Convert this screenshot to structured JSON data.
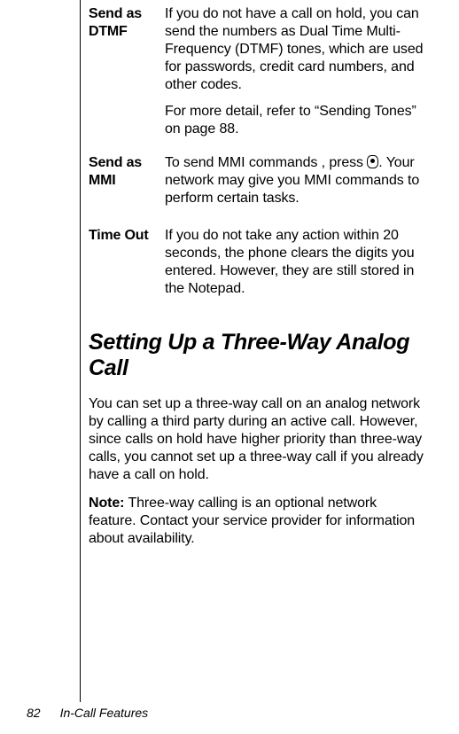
{
  "definitions": [
    {
      "term": "Send as DTMF",
      "desc1": "If you do not have a call on hold, you can send the numbers as Dual Time Multi-Frequency (DTMF) tones, which are used for passwords, credit card numbers, and other codes.",
      "desc2": "For more detail, refer to “Sending Tones” on page 88."
    },
    {
      "term": "Send as MMI",
      "desc_pre": "To send MMI commands , press ",
      "icon": "key-icon",
      "desc_post": ". Your network may give you MMI commands to perform certain tasks."
    },
    {
      "term": "Time Out",
      "desc1": "If you do not take any action within 20 seconds, the phone clears the digits you entered. However, they are still stored in the Notepad."
    }
  ],
  "heading": "Setting Up a Three-Way Analog Call",
  "paragraphs": {
    "p1": "You can set up a three-way call on an analog network by calling a third party during an active call. However, since calls on hold have higher priority than three-way calls, you cannot set up a three-way call if you already have a call on hold.",
    "note_label": "Note:",
    "note_text": " Three-way calling is an optional network feature. Contact your service provider for information about availability."
  },
  "footer": {
    "page_number": "82",
    "chapter_title": "In-Call Features"
  }
}
